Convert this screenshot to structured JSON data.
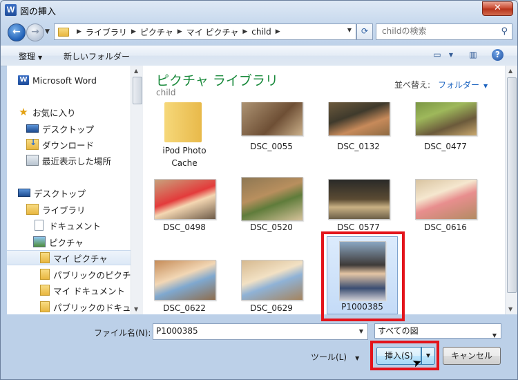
{
  "window": {
    "title": "図の挿入",
    "app_icon": "W",
    "close_glyph": "✕"
  },
  "nav": {
    "back_icon": "arrow-left-icon",
    "forward_icon": "arrow-right-icon",
    "breadcrumb": [
      "ライブラリ",
      "ピクチャ",
      "マイ ピクチャ",
      "child"
    ],
    "search_placeholder": "childの検索"
  },
  "toolbar": {
    "organize": "整理",
    "new_folder": "新しいフォルダー"
  },
  "sidebar": {
    "items": [
      {
        "label": "Microsoft Word",
        "icon": "word-icon"
      },
      {
        "label": "お気に入り",
        "icon": "star-icon"
      },
      {
        "label": "デスクトップ",
        "icon": "desktop-icon"
      },
      {
        "label": "ダウンロード",
        "icon": "download-folder-icon"
      },
      {
        "label": "最近表示した場所",
        "icon": "recent-places-icon"
      },
      {
        "label": "デスクトップ",
        "icon": "desktop-icon"
      },
      {
        "label": "ライブラリ",
        "icon": "library-icon"
      },
      {
        "label": "ドキュメント",
        "icon": "document-icon"
      },
      {
        "label": "ピクチャ",
        "icon": "pictures-icon"
      },
      {
        "label": "マイ ピクチャ",
        "icon": "folder-icon"
      },
      {
        "label": "パブリックのピクチャ",
        "icon": "folder-icon"
      },
      {
        "label": "マイ ドキュメント",
        "icon": "folder-icon"
      },
      {
        "label": "パブリックのドキュメ",
        "icon": "folder-icon"
      }
    ]
  },
  "content": {
    "library_title": "ピクチャ ライブラリ",
    "library_subtitle": "child",
    "sort_label": "並べ替え:",
    "sort_value": "フォルダー",
    "files": [
      {
        "name": "iPod Photo",
        "name2": "Cache",
        "type": "folder"
      },
      {
        "name": "DSC_0055"
      },
      {
        "name": "DSC_0132"
      },
      {
        "name": "DSC_0477"
      },
      {
        "name": "DSC_0498"
      },
      {
        "name": "DSC_0520"
      },
      {
        "name": "DSC_0577"
      },
      {
        "name": "DSC_0616"
      },
      {
        "name": "DSC_0622"
      },
      {
        "name": "DSC_0629"
      },
      {
        "name": "P1000385",
        "selected": true
      }
    ]
  },
  "bottom": {
    "filename_label": "ファイル名(N):",
    "filename_value": "P1000385",
    "filetype_value": "すべての図",
    "tools_label": "ツール(L)",
    "insert_label": "挿入(S)",
    "cancel_label": "キャンセル"
  },
  "colors": {
    "highlight": "#e3141b",
    "library_title": "#1a8a3c",
    "link": "#1d64c0"
  }
}
